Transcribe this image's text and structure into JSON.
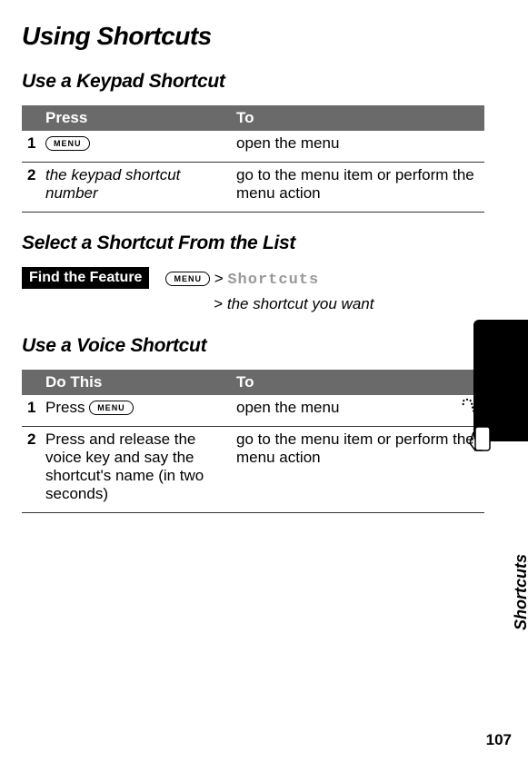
{
  "page": {
    "title": "Using Shortcuts",
    "number": "107",
    "tab_label": "Shortcuts"
  },
  "section1": {
    "heading": "Use a Keypad Shortcut",
    "th1": "Press",
    "th2": "To",
    "rows": [
      {
        "n": "1",
        "left_key": "MENU",
        "right": "open the menu"
      },
      {
        "n": "2",
        "left_italic": "the keypad shortcut number",
        "right": "go to the menu item or perform the menu action"
      }
    ]
  },
  "section2": {
    "heading": "Select a Shortcut From the List",
    "feature_label": "Find the Feature",
    "menu_key": "MENU",
    "path_line1_gt": ">",
    "path_line1_lcd": "Shortcuts",
    "path_line2_gt": ">",
    "path_line2_italic": "the shortcut you want"
  },
  "section3": {
    "heading": "Use a Voice Shortcut",
    "th1": "Do This",
    "th2": "To",
    "rows": [
      {
        "n": "1",
        "left_text": "Press ",
        "left_key": "MENU",
        "right": "open the menu"
      },
      {
        "n": "2",
        "left_text": "Press and release the voice key and say the shortcut's name (in two seconds)",
        "right": "go to the menu item or perform the menu action"
      }
    ]
  }
}
